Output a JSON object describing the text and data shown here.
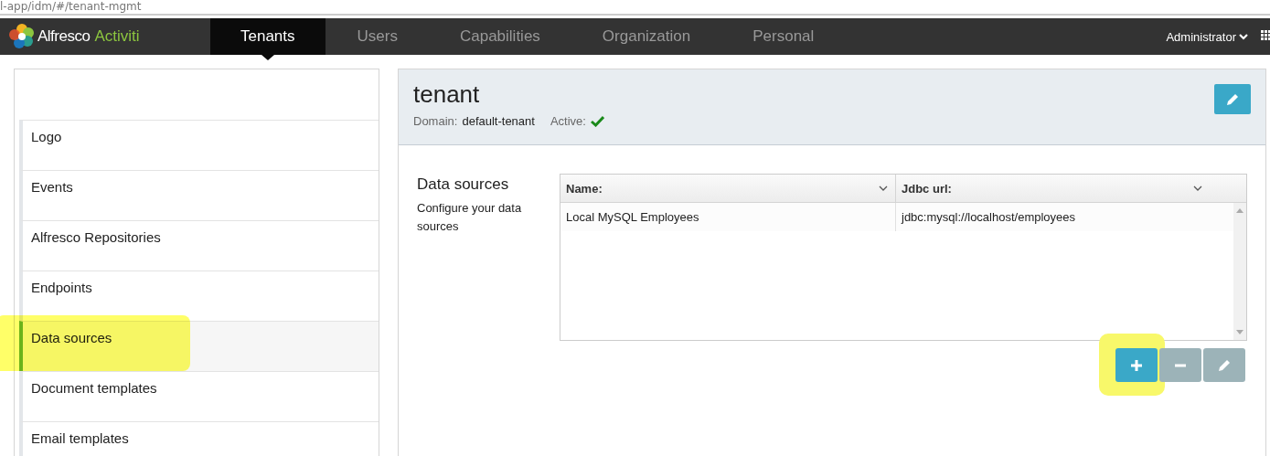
{
  "address_bar": {
    "url": "l-app/idm/#/tenant-mgmt"
  },
  "navbar": {
    "logo": {
      "brand": "Alfresco",
      "product": "Activiti"
    },
    "tabs": [
      {
        "label": "Tenants",
        "selected": true
      },
      {
        "label": "Users",
        "selected": false
      },
      {
        "label": "Capabilities",
        "selected": false
      },
      {
        "label": "Organization",
        "selected": false
      },
      {
        "label": "Personal",
        "selected": false
      }
    ],
    "user_menu": "Administrator"
  },
  "sidebar": {
    "items": [
      {
        "label": "Logo",
        "selected": false,
        "highlighted": false
      },
      {
        "label": "Events",
        "selected": false,
        "highlighted": false
      },
      {
        "label": "Alfresco Repositories",
        "selected": false,
        "highlighted": false
      },
      {
        "label": "Endpoints",
        "selected": false,
        "highlighted": false
      },
      {
        "label": "Data sources",
        "selected": true,
        "highlighted": true
      },
      {
        "label": "Document templates",
        "selected": false,
        "highlighted": false
      },
      {
        "label": "Email templates",
        "selected": false,
        "highlighted": false
      }
    ]
  },
  "tenant": {
    "name": "tenant",
    "domain_label": "Domain:",
    "domain": "default-tenant",
    "active_label": "Active:",
    "active": true
  },
  "section": {
    "title": "Data sources",
    "description": "Configure your data sources",
    "table": {
      "columns": [
        "Name:",
        "Jdbc url:"
      ],
      "rows": [
        [
          "Local MySQL Employees",
          "jdbc:mysql://localhost/employees"
        ]
      ]
    },
    "buttons": [
      {
        "kind": "add",
        "disabled": false,
        "highlighted": true
      },
      {
        "kind": "remove",
        "disabled": true,
        "highlighted": false
      },
      {
        "kind": "edit",
        "disabled": true,
        "highlighted": false
      }
    ]
  }
}
